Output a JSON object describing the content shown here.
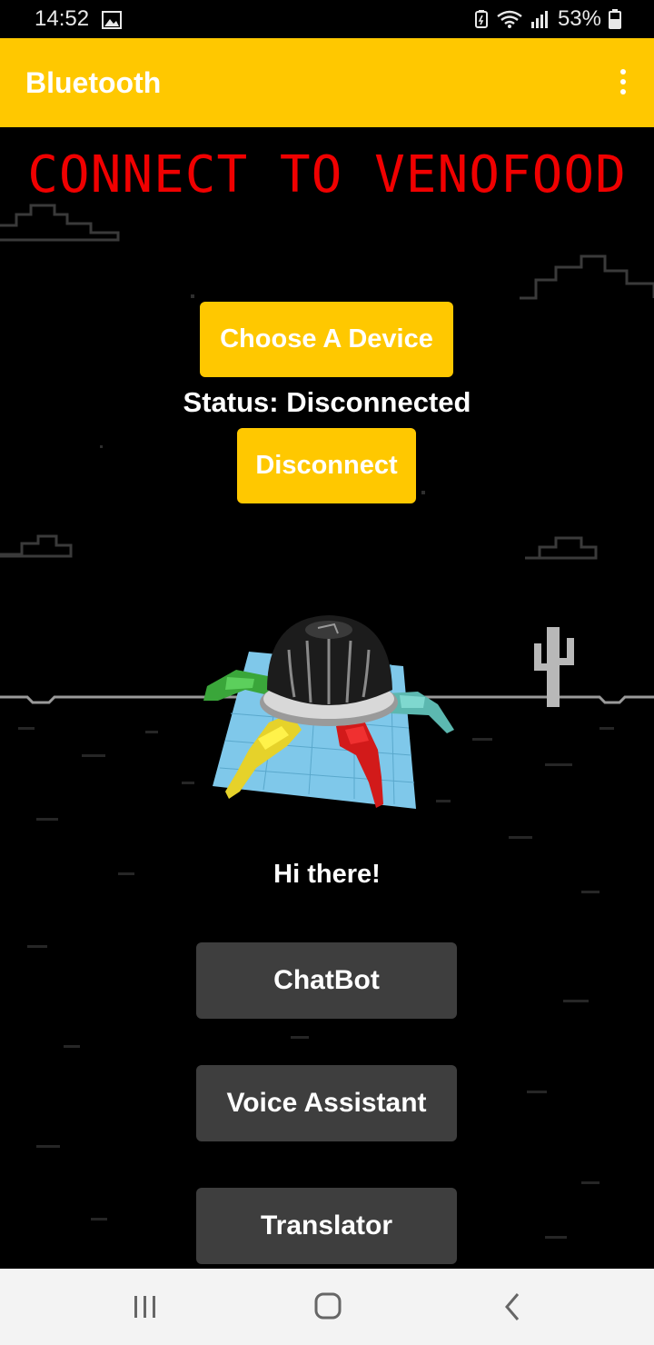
{
  "status_bar": {
    "time": "14:52",
    "battery": "53%",
    "icons": [
      "gallery-icon",
      "battery-saver-icon",
      "wifi-icon",
      "signal-icon",
      "battery-icon"
    ]
  },
  "app_bar": {
    "title": "Bluetooth",
    "menu_icon": "overflow-menu-icon"
  },
  "main": {
    "headline": "CONNECT TO VENOFOOD",
    "choose_device_label": "Choose A Device",
    "status_text": "Status: Disconnected",
    "disconnect_label": "Disconnect",
    "greeting": "Hi there!",
    "buttons": [
      {
        "label": "ChatBot"
      },
      {
        "label": "Voice Assistant"
      },
      {
        "label": "Translator"
      }
    ]
  },
  "nav_bar": {
    "icons": [
      "recents-icon",
      "home-icon",
      "back-icon"
    ]
  },
  "colors": {
    "accent": "#ffc800",
    "headline": "#f00000",
    "button_dark": "#3e3e3e",
    "background": "#000000"
  }
}
